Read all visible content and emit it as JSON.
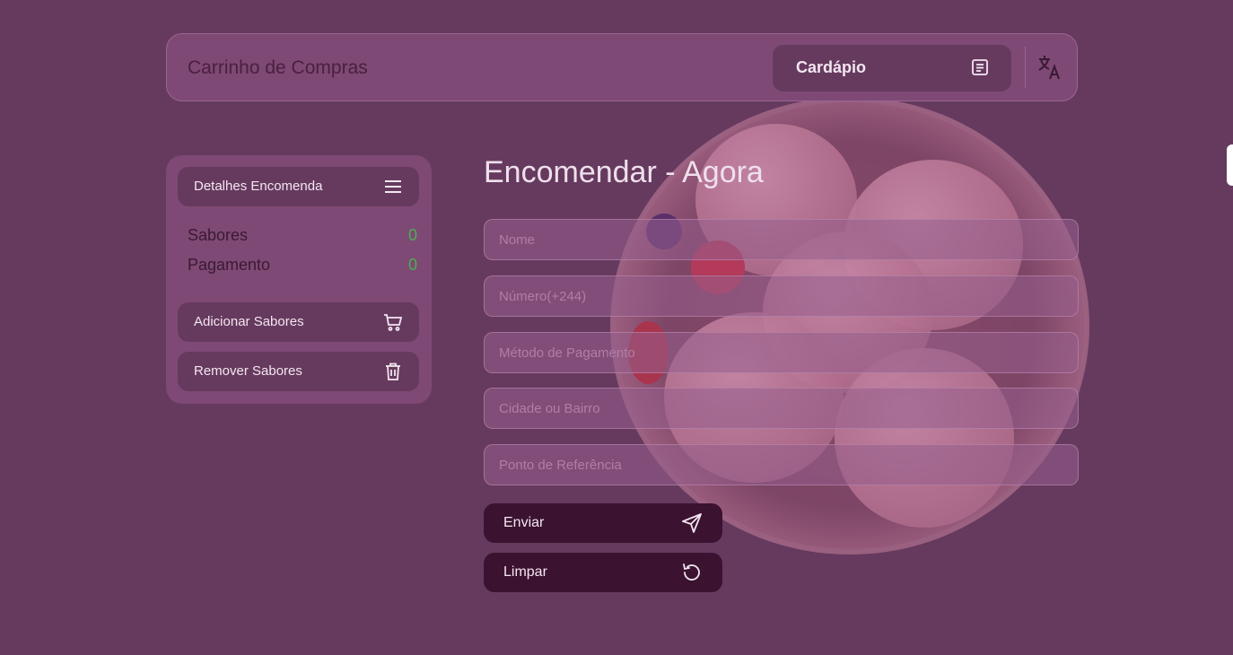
{
  "header": {
    "title": "Carrinho de Compras",
    "menu_label": "Cardápio"
  },
  "sidebar": {
    "details_label": "Detalhes Encomenda",
    "stats": [
      {
        "label": "Sabores",
        "value": "0"
      },
      {
        "label": "Pagamento",
        "value": "0"
      }
    ],
    "add_label": "Adicionar Sabores",
    "remove_label": "Remover Sabores"
  },
  "form": {
    "heading": "Encomendar - Agora",
    "fields": [
      {
        "placeholder": "Nome"
      },
      {
        "placeholder": "Número(+244)"
      },
      {
        "placeholder": "Método de Pagamento"
      },
      {
        "placeholder": "Cidade ou Bairro"
      },
      {
        "placeholder": "Ponto de Referência"
      }
    ],
    "submit_label": "Enviar",
    "clear_label": "Limpar"
  },
  "colors": {
    "background": "#663a5f",
    "panel": "#7e4975",
    "button_dark": "#3b1230",
    "count_green": "#4caf50"
  },
  "icons": [
    "menu-document-icon",
    "translate-icon",
    "hamburger-icon",
    "cart-icon",
    "trash-icon",
    "send-icon",
    "reset-icon"
  ]
}
